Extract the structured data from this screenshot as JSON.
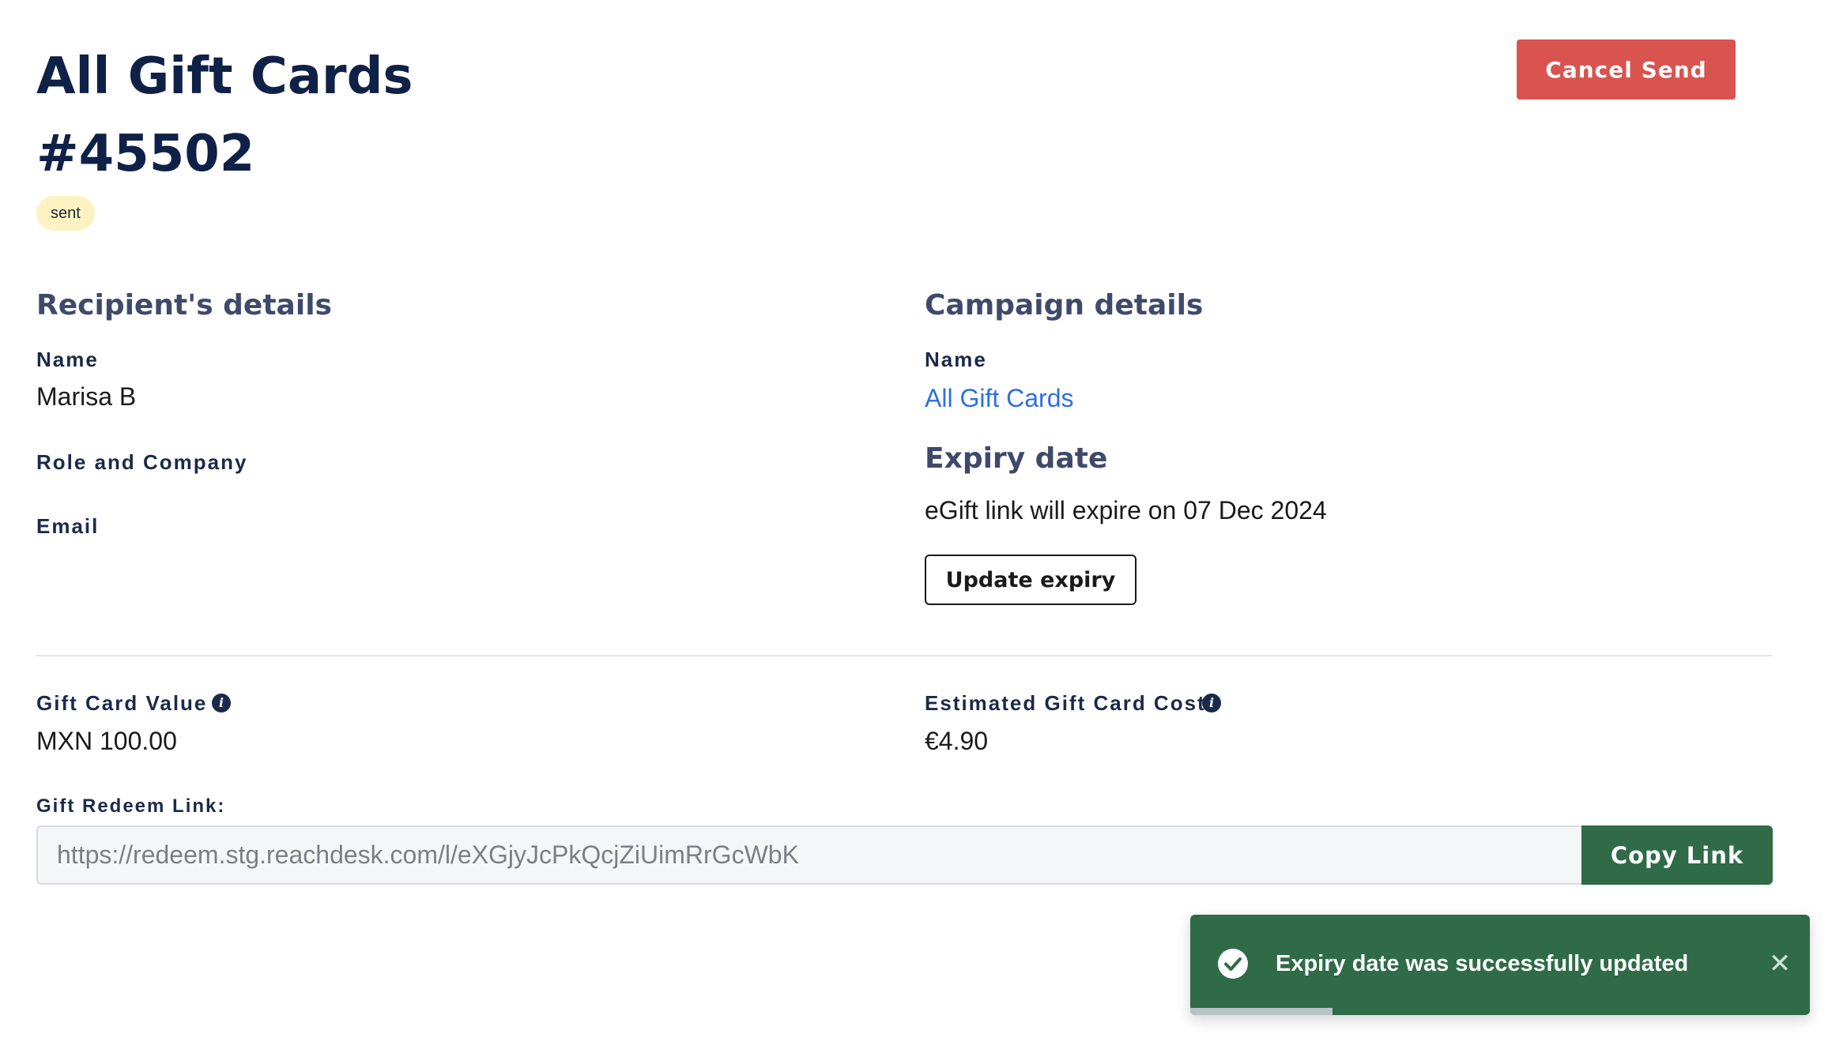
{
  "header": {
    "title_line1": "All Gift Cards",
    "title_line2": "#45502",
    "status": "sent",
    "cancel_label": "Cancel Send"
  },
  "recipient": {
    "heading": "Recipient's details",
    "name_label": "Name",
    "name_value": "Marisa B",
    "role_label": "Role and Company",
    "email_label": "Email"
  },
  "campaign": {
    "heading": "Campaign details",
    "name_label": "Name",
    "name_value": "All Gift Cards",
    "expiry_heading": "Expiry date",
    "expiry_text": "eGift link will expire on 07 Dec 2024",
    "update_label": "Update expiry"
  },
  "value": {
    "label": "Gift Card Value",
    "amount": "MXN 100.00"
  },
  "cost": {
    "label": "Estimated Gift Card Cost",
    "amount": "€4.90"
  },
  "redeem": {
    "label": "Gift Redeem Link:",
    "url": "https://redeem.stg.reachdesk.com/l/eXGjyJcPkQcjZiUimRrGcWbK",
    "copy_label": "Copy Link"
  },
  "toast": {
    "message": "Expiry date was successfully updated",
    "progress": 0.23
  },
  "colors": {
    "title": "#0f2147",
    "danger": "#d9534f",
    "success": "#2f6b47",
    "link": "#2f6fde",
    "badge": "#fdf3c2"
  },
  "icons": {
    "info": "info-icon",
    "toast_check": "check-circle-icon",
    "toast_close": "close-icon"
  }
}
